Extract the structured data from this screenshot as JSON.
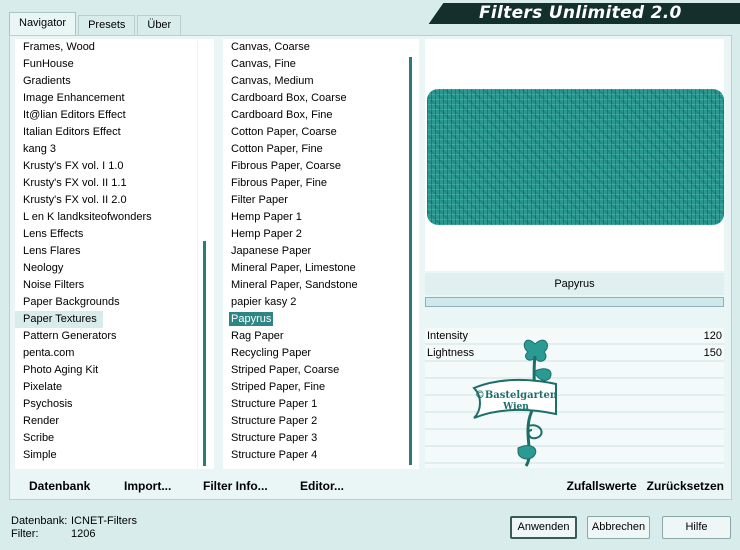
{
  "app": {
    "title": "Filters Unlimited 2.0"
  },
  "tabs": [
    {
      "label": "Navigator",
      "active": true
    },
    {
      "label": "Presets",
      "active": false
    },
    {
      "label": "Über",
      "active": false
    }
  ],
  "categories": {
    "items": [
      "Frames, Wood",
      "FunHouse",
      "Gradients",
      "Image Enhancement",
      "It@lian Editors Effect",
      "Italian Editors Effect",
      "kang 3",
      "Krusty's FX vol. I 1.0",
      "Krusty's FX vol. II 1.1",
      "Krusty's FX vol. II 2.0",
      "L en K landksiteofwonders",
      "Lens Effects",
      "Lens Flares",
      "Neology",
      "Noise Filters",
      "Paper Backgrounds",
      "Paper Textures",
      "Pattern Generators",
      "penta.com",
      "Photo Aging Kit",
      "Pixelate",
      "Psychosis",
      "Render",
      "Scribe",
      "Simple"
    ],
    "selected": "Paper Textures",
    "scroll_position": 0.62
  },
  "filters": {
    "items": [
      "Canvas, Coarse",
      "Canvas, Fine",
      "Canvas, Medium",
      "Cardboard Box, Coarse",
      "Cardboard Box, Fine",
      "Cotton Paper, Coarse",
      "Cotton Paper, Fine",
      "Fibrous Paper, Coarse",
      "Fibrous Paper, Fine",
      "Filter Paper",
      "Hemp Paper 1",
      "Hemp Paper 2",
      "Japanese Paper",
      "Mineral Paper, Limestone",
      "Mineral Paper, Sandstone",
      "papier kasy 2",
      "Papyrus",
      "Rag Paper",
      "Recycling Paper",
      "Striped Paper, Coarse",
      "Striped Paper, Fine",
      "Structure Paper 1",
      "Structure Paper 2",
      "Structure Paper 3",
      "Structure Paper 4"
    ],
    "selected": "Papyrus",
    "scroll_position": 0.0
  },
  "toolbar": {
    "datenbank": "Datenbank",
    "import": "Import...",
    "filter_info": "Filter Info...",
    "editor": "Editor..."
  },
  "preview": {
    "filter_name": "Papyrus",
    "texture_color": "#2a9890",
    "params": [
      {
        "label": "Intensity",
        "value": "120"
      },
      {
        "label": "Lightness",
        "value": "150"
      }
    ],
    "watermark_line1": "©Bastelgarten",
    "watermark_line2": "Wien"
  },
  "actions": {
    "random": "Zufallswerte",
    "reset": "Zurücksetzen"
  },
  "status": {
    "db_label": "Datenbank:",
    "db_value": "ICNET-Filters",
    "filter_label": "Filter:",
    "filter_value": "1206"
  },
  "buttons": {
    "apply": "Anwenden",
    "cancel": "Abbrechen",
    "help": "Hilfe"
  },
  "colors": {
    "accent": "#2e8585",
    "title_bar": "#14302c",
    "background": "#d8ecec"
  }
}
